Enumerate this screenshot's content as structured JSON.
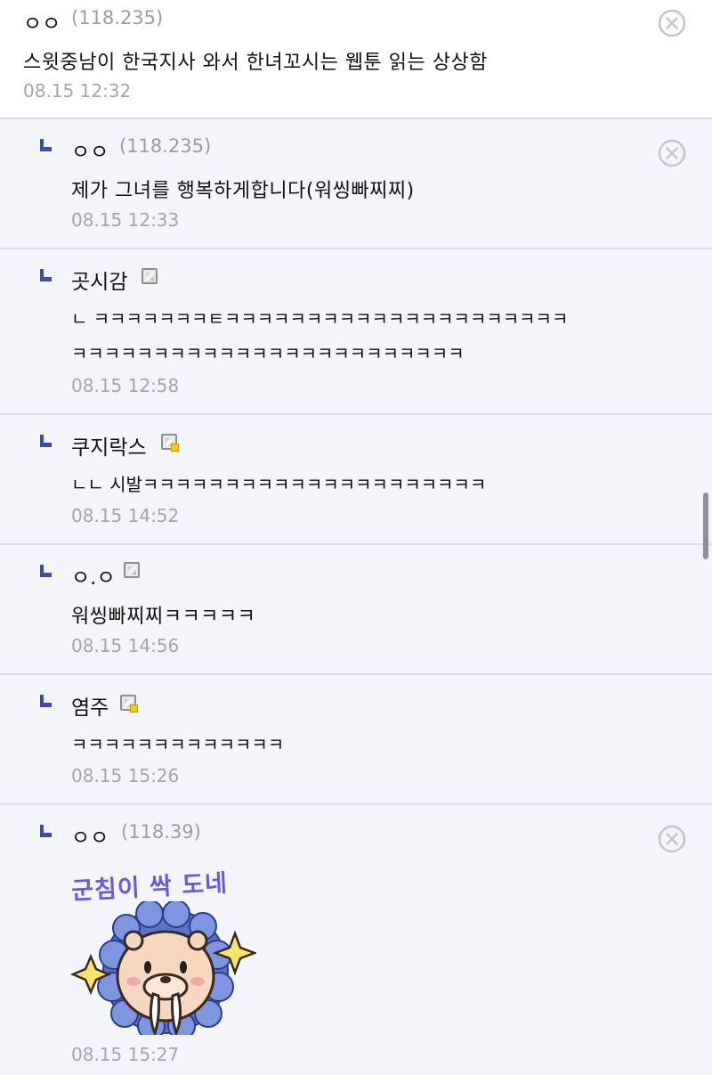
{
  "comments": [
    {
      "nick": "ㅇㅇ",
      "ip": "(118.235)",
      "memo": "스윗중남이 한국지사 와서 한녀꼬시는 웹툰 읽는 상상함",
      "time": "08.15 12:32"
    },
    {
      "nick": "ㅇㅇ",
      "ip": "(118.235)",
      "memo": "제가 그녀를 행복하게합니다(워씽빠찌찌)",
      "time": "08.15 12:33"
    },
    {
      "nick": "곳시감",
      "memo_line1": "ㄴ ㅋㅋㅋㅋㅋㅋㅋㅌㅋㅋㅋㅋㅋㅋㅋㅋㅋㅋㅋㅋㅋㅋㅋㅋㅋㅋㅋㅋㅋ",
      "memo_line2": "ㅋㅋㅋㅋㅋㅋㅋㅋㅋㅋㅋㅋㅋㅋㅋㅋㅋㅋㅋㅋㅋㅋㅋㅋ",
      "time": "08.15 12:58"
    },
    {
      "nick": "쿠지락스",
      "memo": "ㄴㄴ 시발ㅋㅋㅋㅋㅋㅋㅋㅋㅋㅋㅋㅋㅋㅋㅋㅋㅋㅋㅋㅋㅋ",
      "time": "08.15 14:52"
    },
    {
      "nick": "ㅇ.ㅇ",
      "memo": "워씽빠찌찌ㅋㅋㅋㅋㅋ",
      "time": "08.15 14:56"
    },
    {
      "nick": "염주",
      "memo": "ㅋㅋㅋㅋㅋㅋㅋㅋㅋㅋㅋㅋㅋ",
      "time": "08.15 15:26"
    },
    {
      "nick": "ㅇㅇ",
      "ip": "(118.39)",
      "sticker_text": "군침이 싹 도네",
      "time": "08.15 15:27"
    }
  ],
  "icons": {
    "reply": "reply-arrow-icon",
    "delete": "delete-circle-icon",
    "gallog": "gallog-badge-icon"
  },
  "colors": {
    "reply_arrow": "#3d4caa",
    "ip_text": "#9a9ca6",
    "time_text": "#a3a5ad",
    "sticker_text": "#6e57d8",
    "sticker_body": "#f6d7c0",
    "sticker_mane": "#5b72c8"
  }
}
